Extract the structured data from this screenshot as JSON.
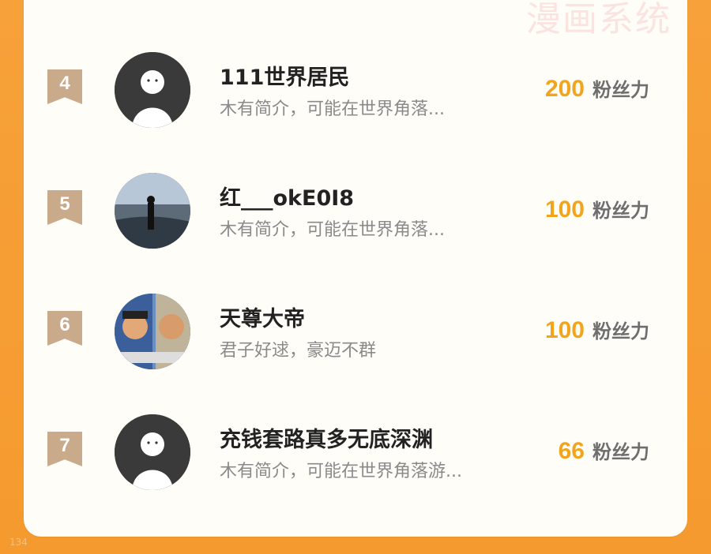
{
  "watermark": "漫画系统",
  "page_number": "134",
  "points_unit": "粉丝力",
  "ranking": [
    {
      "rank": "4",
      "name": "111世界居民",
      "bio": "木有简介，可能在世界角落...",
      "points": "200",
      "avatar": "default-avatar"
    },
    {
      "rank": "5",
      "name": "红___okE0I8",
      "bio": "木有简介，可能在世界角落...",
      "points": "100",
      "avatar": "photo-avatar-sea"
    },
    {
      "rank": "6",
      "name": "天尊大帝",
      "bio": "君子好逑，豪迈不群",
      "points": "100",
      "avatar": "photo-avatar-anime"
    },
    {
      "rank": "7",
      "name": "充钱套路真多无底深渊",
      "bio": "木有简介，可能在世界角落游...",
      "points": "66",
      "avatar": "default-avatar"
    }
  ],
  "colors": {
    "background": "#f59a2e",
    "rank_badge": "#c9ab8c",
    "points": "#f2a51c"
  }
}
